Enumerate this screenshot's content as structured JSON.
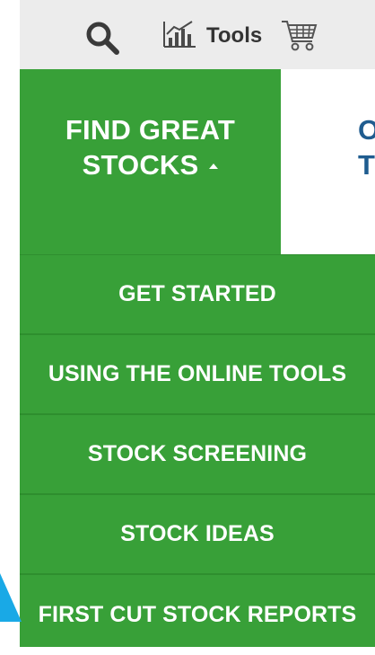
{
  "topbar": {
    "search_icon": "search-icon",
    "tools_icon": "bar-chart-icon",
    "tools_label": "Tools",
    "cart_icon": "shopping-cart-icon"
  },
  "nav": {
    "active": {
      "line1": "FIND GREAT",
      "line2": "STOCKS"
    },
    "next_partial": {
      "line1": "O",
      "line2": "TO"
    }
  },
  "dropdown": {
    "items": [
      "GET STARTED",
      "USING THE ONLINE TOOLS",
      "STOCK SCREENING",
      "STOCK IDEAS",
      "FIRST CUT STOCK REPORTS"
    ]
  },
  "colors": {
    "green": "#38a038",
    "blue_text": "#1f5c8f",
    "topbar_bg": "#ececec",
    "arrow_blue": "#19a9e6"
  }
}
